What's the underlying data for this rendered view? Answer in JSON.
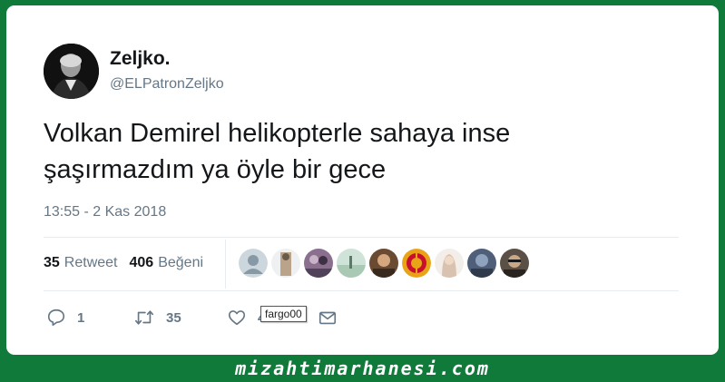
{
  "author": {
    "display_name": "Zeljko.",
    "handle": "@ELPatronZeljko"
  },
  "tweet": {
    "text_line1": "Volkan Demirel helikopterle sahaya inse",
    "text_line2": "şaşırmazdım ya öyle bir gece",
    "timestamp": "13:55 - 2 Kas 2018"
  },
  "stats": {
    "retweet_count": "35",
    "retweet_label": "Retweet",
    "like_count": "406",
    "like_label": "Beğeni"
  },
  "likers": [
    {
      "icon": "default-avatar-icon",
      "color": "#ccd6dd"
    },
    {
      "icon": "user-photo",
      "color": "#b9a38a"
    },
    {
      "icon": "user-photo",
      "color": "#8a6f8f"
    },
    {
      "icon": "user-photo",
      "color": "#a9c9b5"
    },
    {
      "icon": "user-photo",
      "color": "#6b4a32"
    },
    {
      "icon": "galatasaray-logo",
      "color": "#e8a317"
    },
    {
      "icon": "user-photo",
      "color": "#d9c3b0"
    },
    {
      "icon": "user-photo",
      "color": "#4f5f7a"
    },
    {
      "icon": "user-photo",
      "color": "#5a5046"
    }
  ],
  "actions": {
    "reply_count": "1",
    "retweet_count": "35",
    "like_count": "406"
  },
  "tooltip": {
    "text": "fargo00"
  },
  "watermark": {
    "text": "mizahtimarhanesi.com"
  },
  "colors": {
    "frame": "#0f7a3a",
    "card": "#ffffff",
    "primary_text": "#14171a",
    "secondary_text": "#657786",
    "divider": "#e6ecf0"
  }
}
